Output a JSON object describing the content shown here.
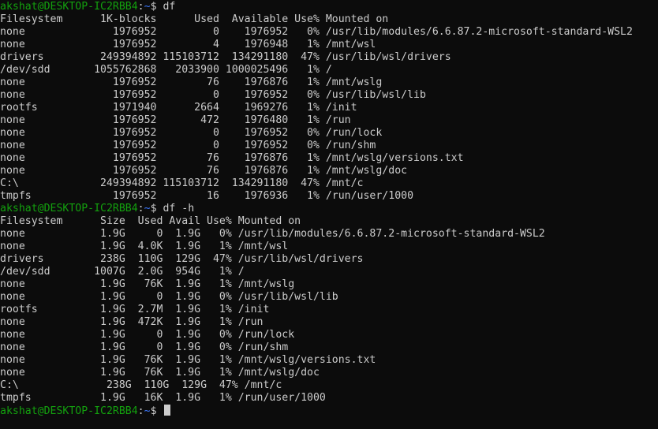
{
  "terminal": {
    "lines": [
      {
        "type": "prompt",
        "user": "akshat@DESKTOP-IC2RBB4",
        "path": "~",
        "symbol": "$",
        "command": "df"
      },
      {
        "type": "text",
        "text": "Filesystem      1K-blocks      Used  Available Use% Mounted on"
      },
      {
        "type": "text",
        "text": "none              1976952         0    1976952   0% /usr/lib/modules/6.6.87.2-microsoft-standard-WSL2"
      },
      {
        "type": "text",
        "text": "none              1976952         4    1976948   1% /mnt/wsl"
      },
      {
        "type": "text",
        "text": "drivers         249394892 115103712  134291180  47% /usr/lib/wsl/drivers"
      },
      {
        "type": "text",
        "text": "/dev/sdd       1055762868   2033900 1000025496   1% /"
      },
      {
        "type": "text",
        "text": "none              1976952        76    1976876   1% /mnt/wslg"
      },
      {
        "type": "text",
        "text": "none              1976952         0    1976952   0% /usr/lib/wsl/lib"
      },
      {
        "type": "text",
        "text": "rootfs            1971940      2664    1969276   1% /init"
      },
      {
        "type": "text",
        "text": "none              1976952       472    1976480   1% /run"
      },
      {
        "type": "text",
        "text": "none              1976952         0    1976952   0% /run/lock"
      },
      {
        "type": "text",
        "text": "none              1976952         0    1976952   0% /run/shm"
      },
      {
        "type": "text",
        "text": "none              1976952        76    1976876   1% /mnt/wslg/versions.txt"
      },
      {
        "type": "text",
        "text": "none              1976952        76    1976876   1% /mnt/wslg/doc"
      },
      {
        "type": "text",
        "text": "C:\\             249394892 115103712  134291180  47% /mnt/c"
      },
      {
        "type": "text",
        "text": "tmpfs             1976952        16    1976936   1% /run/user/1000"
      },
      {
        "type": "prompt",
        "user": "akshat@DESKTOP-IC2RBB4",
        "path": "~",
        "symbol": "$",
        "command": "df -h"
      },
      {
        "type": "text",
        "text": "Filesystem      Size  Used Avail Use% Mounted on"
      },
      {
        "type": "text",
        "text": "none            1.9G     0  1.9G   0% /usr/lib/modules/6.6.87.2-microsoft-standard-WSL2"
      },
      {
        "type": "text",
        "text": "none            1.9G  4.0K  1.9G   1% /mnt/wsl"
      },
      {
        "type": "text",
        "text": "drivers         238G  110G  129G  47% /usr/lib/wsl/drivers"
      },
      {
        "type": "text",
        "text": "/dev/sdd       1007G  2.0G  954G   1% /"
      },
      {
        "type": "text",
        "text": "none            1.9G   76K  1.9G   1% /mnt/wslg"
      },
      {
        "type": "text",
        "text": "none            1.9G     0  1.9G   0% /usr/lib/wsl/lib"
      },
      {
        "type": "text",
        "text": "rootfs          1.9G  2.7M  1.9G   1% /init"
      },
      {
        "type": "text",
        "text": "none            1.9G  472K  1.9G   1% /run"
      },
      {
        "type": "text",
        "text": "none            1.9G     0  1.9G   0% /run/lock"
      },
      {
        "type": "text",
        "text": "none            1.9G     0  1.9G   0% /run/shm"
      },
      {
        "type": "text",
        "text": "none            1.9G   76K  1.9G   1% /mnt/wslg/versions.txt"
      },
      {
        "type": "text",
        "text": "none            1.9G   76K  1.9G   1% /mnt/wslg/doc"
      },
      {
        "type": "text",
        "text": "C:\\              238G  110G  129G  47% /mnt/c"
      },
      {
        "type": "text",
        "text": "tmpfs           1.9G   16K  1.9G   1% /run/user/1000"
      },
      {
        "type": "prompt",
        "user": "akshat@DESKTOP-IC2RBB4",
        "path": "~",
        "symbol": "$",
        "command": "",
        "cursor": true
      }
    ]
  },
  "colors": {
    "background": "#0c0c0c",
    "foreground": "#cccccc",
    "prompt_user": "#13a10e",
    "prompt_path": "#3b78ff"
  }
}
